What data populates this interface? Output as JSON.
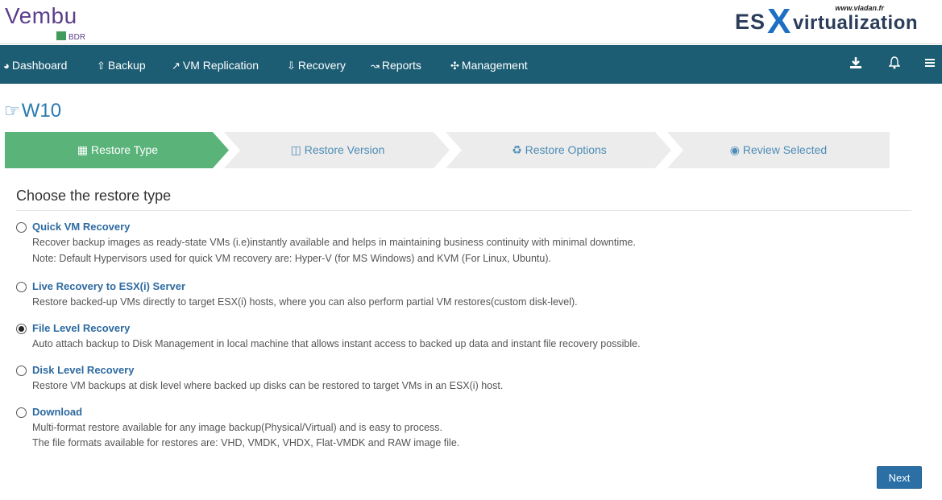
{
  "header": {
    "logo_text": "Vembu",
    "logo_sub": "BDR",
    "brand_site": "www.vladan.fr",
    "brand_es": "ES",
    "brand_x": "X",
    "brand_virt": "virtualization"
  },
  "nav": {
    "items": [
      {
        "label": "Dashboard",
        "icon": "dashboard-icon"
      },
      {
        "label": "Backup",
        "icon": "upload-icon"
      },
      {
        "label": "VM Replication",
        "icon": "share-icon"
      },
      {
        "label": "Recovery",
        "icon": "download-icon"
      },
      {
        "label": "Reports",
        "icon": "chart-icon"
      },
      {
        "label": "Management",
        "icon": "gear-icon"
      }
    ],
    "right_icons": [
      "download-icon",
      "bell-icon",
      "menu-icon"
    ]
  },
  "page": {
    "title": "W10"
  },
  "steps": [
    {
      "label": "Restore Type",
      "icon": "grid-icon",
      "active": true
    },
    {
      "label": "Restore Version",
      "icon": "calendar-icon",
      "active": false
    },
    {
      "label": "Restore Options",
      "icon": "recycle-icon",
      "active": false
    },
    {
      "label": "Review Selected",
      "icon": "eye-icon",
      "active": false
    }
  ],
  "content": {
    "section_title": "Choose the restore type",
    "options": [
      {
        "title": "Quick VM Recovery",
        "desc": [
          "Recover backup images as ready-state VMs (i.e)instantly available and helps in maintaining business continuity with minimal downtime.",
          "Note: Default Hypervisors used for quick VM recovery are: Hyper-V (for MS Windows) and KVM (For Linux, Ubuntu)."
        ],
        "selected": false
      },
      {
        "title": "Live Recovery to ESX(i) Server",
        "desc": [
          "Restore backed-up VMs directly to target ESX(i) hosts, where you can also perform partial VM restores(custom disk-level)."
        ],
        "selected": false
      },
      {
        "title": "File Level Recovery",
        "desc": [
          "Auto attach backup to Disk Management in local machine that allows instant access to backed up data and instant file recovery possible."
        ],
        "selected": true
      },
      {
        "title": "Disk Level Recovery",
        "desc": [
          "Restore VM backups at disk level where backed up disks can be restored to target VMs in an ESX(i) host."
        ],
        "selected": false
      },
      {
        "title": "Download",
        "desc": [
          "Multi-format restore available for any image backup(Physical/Virtual) and is easy to process.",
          "The file formats available for restores are: VHD, VMDK, VHDX, Flat-VMDK and RAW image file."
        ],
        "selected": false
      }
    ],
    "next_label": "Next"
  },
  "colors": {
    "navbar": "#1c5d74",
    "active_step": "#5ab47a",
    "inactive_step": "#ececec",
    "link": "#2d6aa0",
    "button": "#2a6fa6"
  }
}
